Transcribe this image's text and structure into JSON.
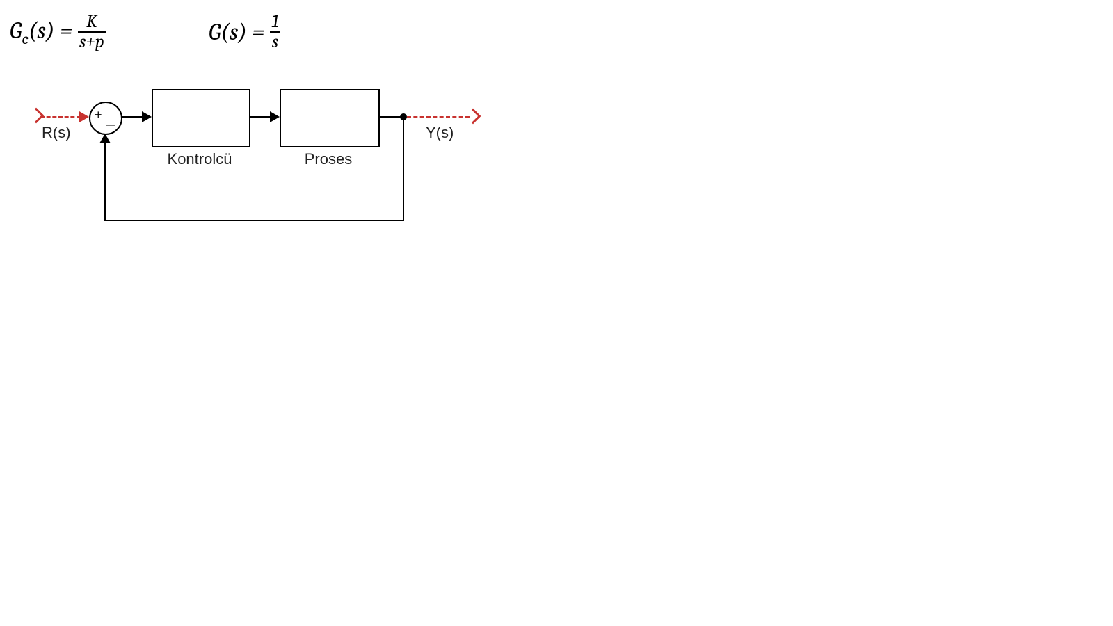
{
  "formulas": {
    "gc_lhs_g": "G",
    "gc_lhs_sub": "c",
    "gc_lhs_arg": "(s) =",
    "gc_num": "K",
    "gc_den": "s+p",
    "g_lhs": "G(s) =",
    "g_num": "1",
    "g_den": "s"
  },
  "diagram": {
    "input_label": "R(s)",
    "output_label": "Y(s)",
    "sum_plus": "+",
    "sum_minus": "_",
    "controller_label": "Kontrolcü",
    "process_label": "Proses"
  }
}
